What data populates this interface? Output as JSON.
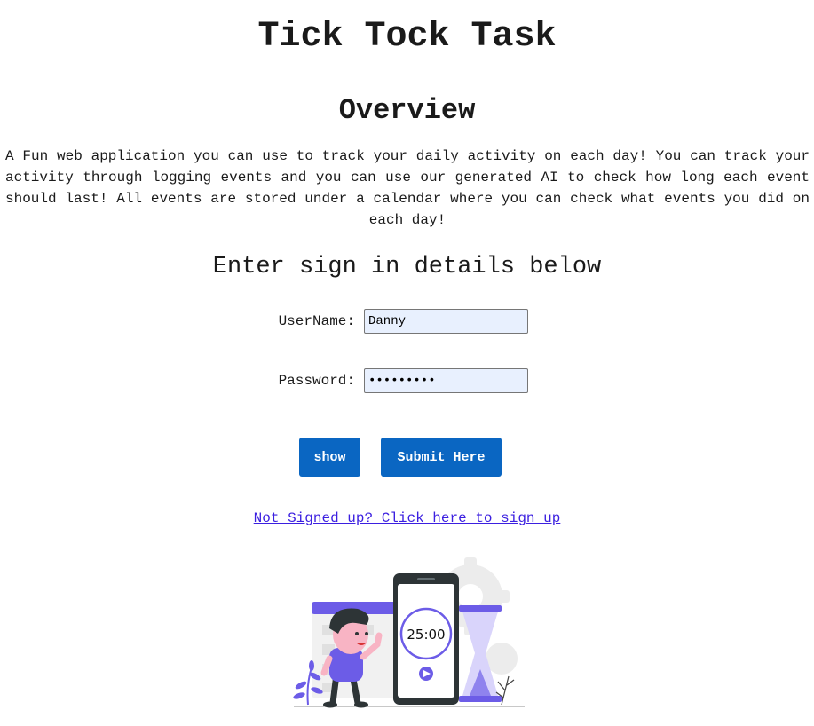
{
  "header": {
    "title": "Tick Tock Task"
  },
  "overview": {
    "heading": "Overview",
    "text": "A Fun web application you can use to track your daily activity on each day! You can track your activity through logging events and you can use our generated AI to check how long each event should last! All events are stored under a calendar where you can check what events you did on each day!"
  },
  "signin": {
    "heading": "Enter sign in details below",
    "username_label": "UserName:",
    "username_value": "Danny",
    "password_label": "Password:",
    "password_value": "dannypass",
    "show_button": "show",
    "submit_button": "Submit Here",
    "signup_link": "Not Signed up? Click here to sign up"
  },
  "illustration": {
    "timer_text": "25:00"
  },
  "colors": {
    "button_bg": "#0a66c2",
    "input_bg": "#e8f0fe",
    "link": "#3b1fe0",
    "accent_purple": "#6c5ce7"
  }
}
